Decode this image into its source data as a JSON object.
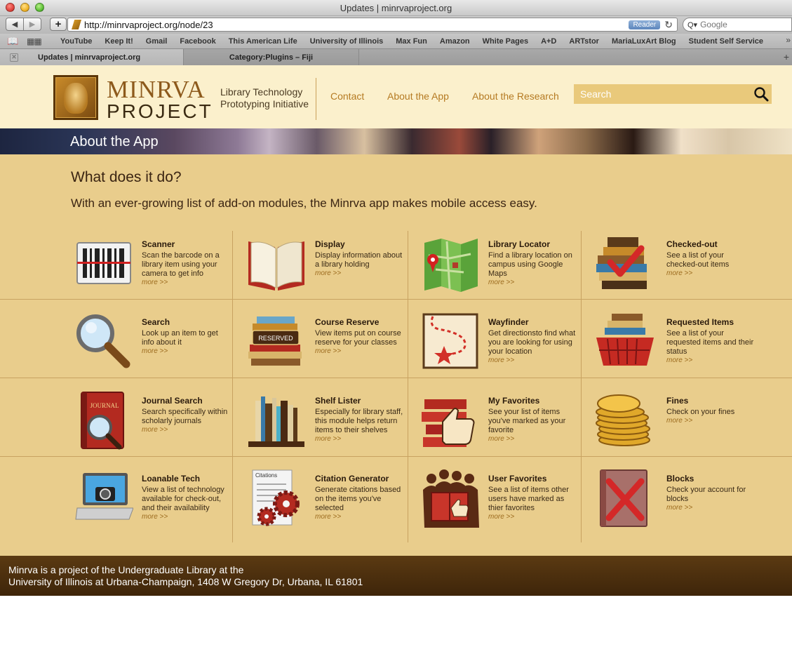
{
  "window": {
    "title": "Updates | minrvaproject.org"
  },
  "toolbar": {
    "back_label": "◀",
    "forward_label": "▶",
    "add_label": "+",
    "url": "http://minrvaproject.org/node/23",
    "reader_label": "Reader",
    "reload_icon": "reload-icon",
    "search_placeholder": "Google"
  },
  "bookmarks": [
    "YouTube",
    "Keep It!",
    "Gmail",
    "Facebook",
    "This American Life",
    "University of Illinois",
    "Max Fun",
    "Amazon",
    "White Pages",
    "A+D",
    "ARTstor",
    "MariaLuxArt Blog",
    "Student Self Service"
  ],
  "tabs": [
    {
      "label": "Updates | minrvaproject.org",
      "active": true
    },
    {
      "label": "Category:Plugins – Fiji",
      "active": false
    }
  ],
  "header": {
    "logo_line1": "MINRVA",
    "logo_line2": "PROJECT",
    "tagline": "Library Technology Prototyping Initiative",
    "nav": [
      "Contact",
      "About the App",
      "About the Research"
    ],
    "search_placeholder": "Search",
    "accent_color": "#b57a22"
  },
  "banner": {
    "title": "About the App"
  },
  "main": {
    "heading": "What does it do?",
    "intro": "With an ever-growing list of add-on modules, the Minrva app makes mobile access easy."
  },
  "modules": [
    {
      "title": "Scanner",
      "desc": "Scan the barcode on a library item using your camera to get info",
      "more": "more >>",
      "icon": "barcode-scanner-icon"
    },
    {
      "title": "Display",
      "desc": "Display information about a library holding",
      "more": "more >>",
      "icon": "open-book-icon"
    },
    {
      "title": "Library Locator",
      "desc": "Find a library location on campus using Google Maps",
      "more": "more >>",
      "icon": "map-pin-icon"
    },
    {
      "title": "Checked-out",
      "desc": "See a list of your checked-out items",
      "more": "more >>",
      "icon": "book-stack-check-icon"
    },
    {
      "title": "Search",
      "desc": "Look up an item to get info about it",
      "more": "more >>",
      "icon": "magnifier-icon"
    },
    {
      "title": "Course Reserve",
      "desc": "View items put on course reserve for your classes",
      "more": "more >>",
      "icon": "reserved-books-icon",
      "badge": "RESERVED"
    },
    {
      "title": "Wayfinder",
      "desc": "Get directionsto find what you are looking for using your location",
      "more": "more >>",
      "icon": "route-map-icon"
    },
    {
      "title": "Requested Items",
      "desc": "See a list of your requested items and their status",
      "more": "more >>",
      "icon": "book-basket-icon"
    },
    {
      "title": "Journal Search",
      "desc": "Search specifically within scholarly journals",
      "more": "more >>",
      "icon": "journal-magnifier-icon",
      "badge": "JOURNAL"
    },
    {
      "title": "Shelf Lister",
      "desc": "Especially for library staff, this module helps return items to their shelves",
      "more": "more >>",
      "icon": "bookshelf-icon"
    },
    {
      "title": "My Favorites",
      "desc": "See your list of items you've marked as your favorite",
      "more": "more >>",
      "icon": "thumbs-up-books-icon"
    },
    {
      "title": "Fines",
      "desc": "Check on your fines",
      "more": "more >>",
      "icon": "coins-icon"
    },
    {
      "title": "Loanable Tech",
      "desc": "View a list of technology available for check-out, and their availability",
      "more": "more >>",
      "icon": "laptop-camera-icon"
    },
    {
      "title": "Citation Generator",
      "desc": "Generate citations based on the items you've selected",
      "more": "more >>",
      "icon": "citations-gears-icon",
      "badge": "Citations"
    },
    {
      "title": "User Favorites",
      "desc": "See a list of items other users have marked as thier favorites",
      "more": "more >>",
      "icon": "crowd-thumbs-up-icon"
    },
    {
      "title": "Blocks",
      "desc": "Check your account for blocks",
      "more": "more >>",
      "icon": "blocked-book-icon"
    }
  ],
  "footer": {
    "line1": "Minrva is a project of the Undergraduate Library at the",
    "line2": "University of Illinois at Urbana-Champaign, 1408 W Gregory Dr, Urbana, IL 61801"
  }
}
